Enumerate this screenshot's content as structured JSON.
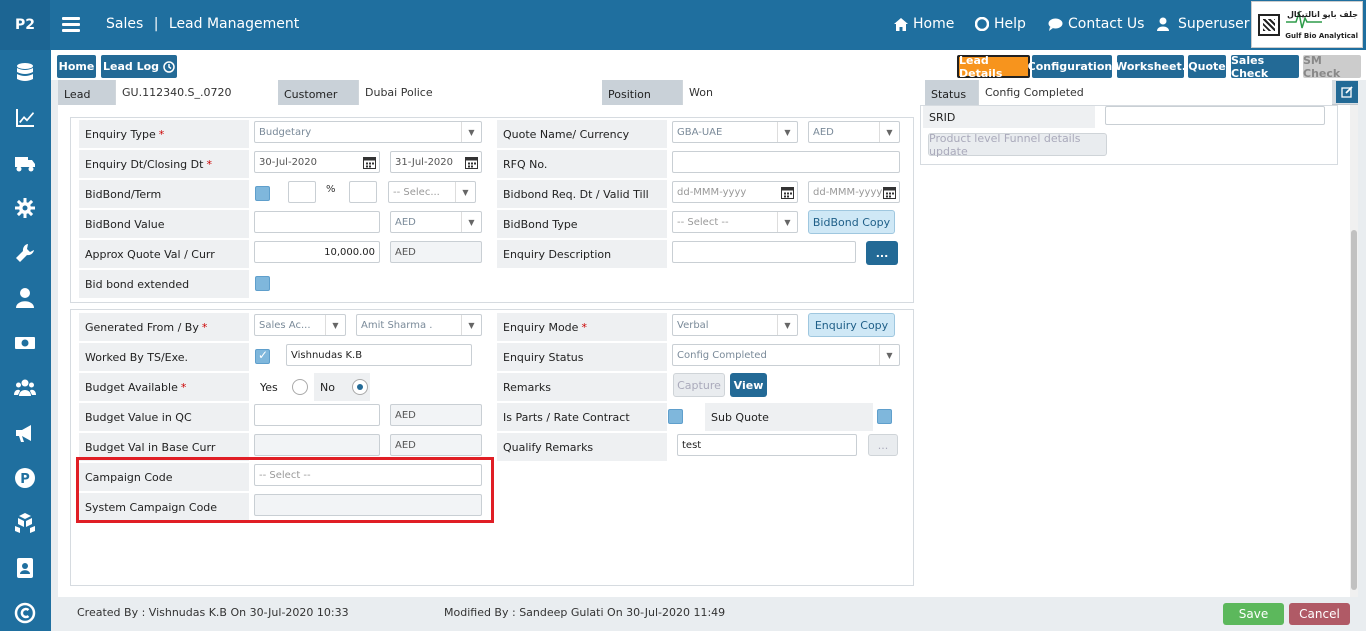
{
  "header": {
    "logo": "P2",
    "module": "Sales",
    "separator": "|",
    "page": "Lead Management",
    "nav": {
      "home": "Home",
      "help": "Help",
      "contact": "Contact Us",
      "user": "Superuser"
    },
    "brand_ar": "جلف بايو انالتيكال",
    "brand_en": "Gulf Bio Analytical"
  },
  "sidebar": {
    "icons": [
      "database-icon",
      "chart-icon",
      "truck-icon",
      "gear-icon",
      "wrench-icon",
      "user-icon",
      "money-icon",
      "users-icon",
      "megaphone-icon",
      "parking-icon",
      "boxes-icon",
      "contact-book-icon",
      "copyright-icon"
    ]
  },
  "tabs": {
    "home": "Home",
    "lead_log": "Lead Log",
    "lead_details": "Lead Details",
    "configuration": "Configuration.",
    "worksheet": "Worksheet.",
    "quote": "Quote",
    "sales_check": "Sales Check",
    "sm_check": "SM Check"
  },
  "info": {
    "lead_label": "Lead",
    "lead_value": "GU.112340.S_.0720",
    "customer_label": "Customer",
    "customer_value": "Dubai Police",
    "position_label": "Position",
    "position_value": "Won",
    "status_label": "Status",
    "status_value": "Config Completed"
  },
  "right_panel": {
    "srid_label": "SRID",
    "funnel_button": "Product level Funnel details update"
  },
  "section1": {
    "enquiry_type_label": "Enquiry Type",
    "enquiry_type_value": "Budgetary",
    "enquiry_dt_label": "Enquiry Dt/Closing Dt",
    "enquiry_dt": "30-Jul-2020",
    "closing_dt": "31-Jul-2020",
    "bidbond_term_label": "BidBond/Term",
    "percent_sign": "%",
    "term_select": "-- Selec...",
    "bidbond_value_label": "BidBond Value",
    "bidbond_currency": "AED",
    "approx_label": "Approx Quote Val / Curr",
    "approx_value": "10,000.00",
    "approx_currency": "AED",
    "bidbond_ext_label": "Bid bond extended",
    "quote_name_label": "Quote Name/ Currency",
    "quote_name_value": "GBA-UAE",
    "quote_currency": "AED",
    "rfq_label": "RFQ No.",
    "bidbond_req_label": "Bidbond Req. Dt / Valid Till",
    "date_placeholder": "dd-MMM-yyyy",
    "bidbond_type_label": "BidBond Type",
    "bidbond_type_value": "-- Select --",
    "bidbond_copy": "BidBond Copy",
    "enquiry_desc_label": "Enquiry Description",
    "ellipsis": "..."
  },
  "section2": {
    "generated_label": "Generated From / By",
    "generated_from": "Sales Ac...",
    "generated_by": "Amit Sharma .",
    "worked_label": "Worked By TS/Exe.",
    "worked_value": "Vishnudas K.B",
    "budget_avail_label": "Budget Available",
    "yes": "Yes",
    "no": "No",
    "budget_qc_label": "Budget Value in QC",
    "budget_qc_currency": "AED",
    "budget_base_label": "Budget Val in Base Curr",
    "budget_base_currency": "AED",
    "campaign_label": "Campaign Code",
    "campaign_value": "-- Select --",
    "sys_campaign_label": "System Campaign Code",
    "enquiry_mode_label": "Enquiry Mode",
    "enquiry_mode_value": "Verbal",
    "enquiry_copy": "Enquiry Copy",
    "enquiry_status_label": "Enquiry Status",
    "enquiry_status_value": "Config Completed",
    "remarks_label": "Remarks",
    "capture": "Capture",
    "view": "View",
    "parts_label": "Is Parts / Rate Contract",
    "sub_quote_label": "Sub Quote",
    "qualify_label": "Qualify Remarks",
    "qualify_value": "test",
    "ellipsis": "..."
  },
  "footer": {
    "created": "Created By : Vishnudas K.B On 30-Jul-2020 10:33",
    "modified": "Modified By : Sandeep Gulati On 30-Jul-2020 11:49",
    "save": "Save",
    "cancel": "Cancel"
  },
  "colors": {
    "primary": "#1f6f9f",
    "active_tab": "#f7941d",
    "save": "#5cb85c",
    "cancel": "#b05a66",
    "highlight": "#e01e25"
  }
}
